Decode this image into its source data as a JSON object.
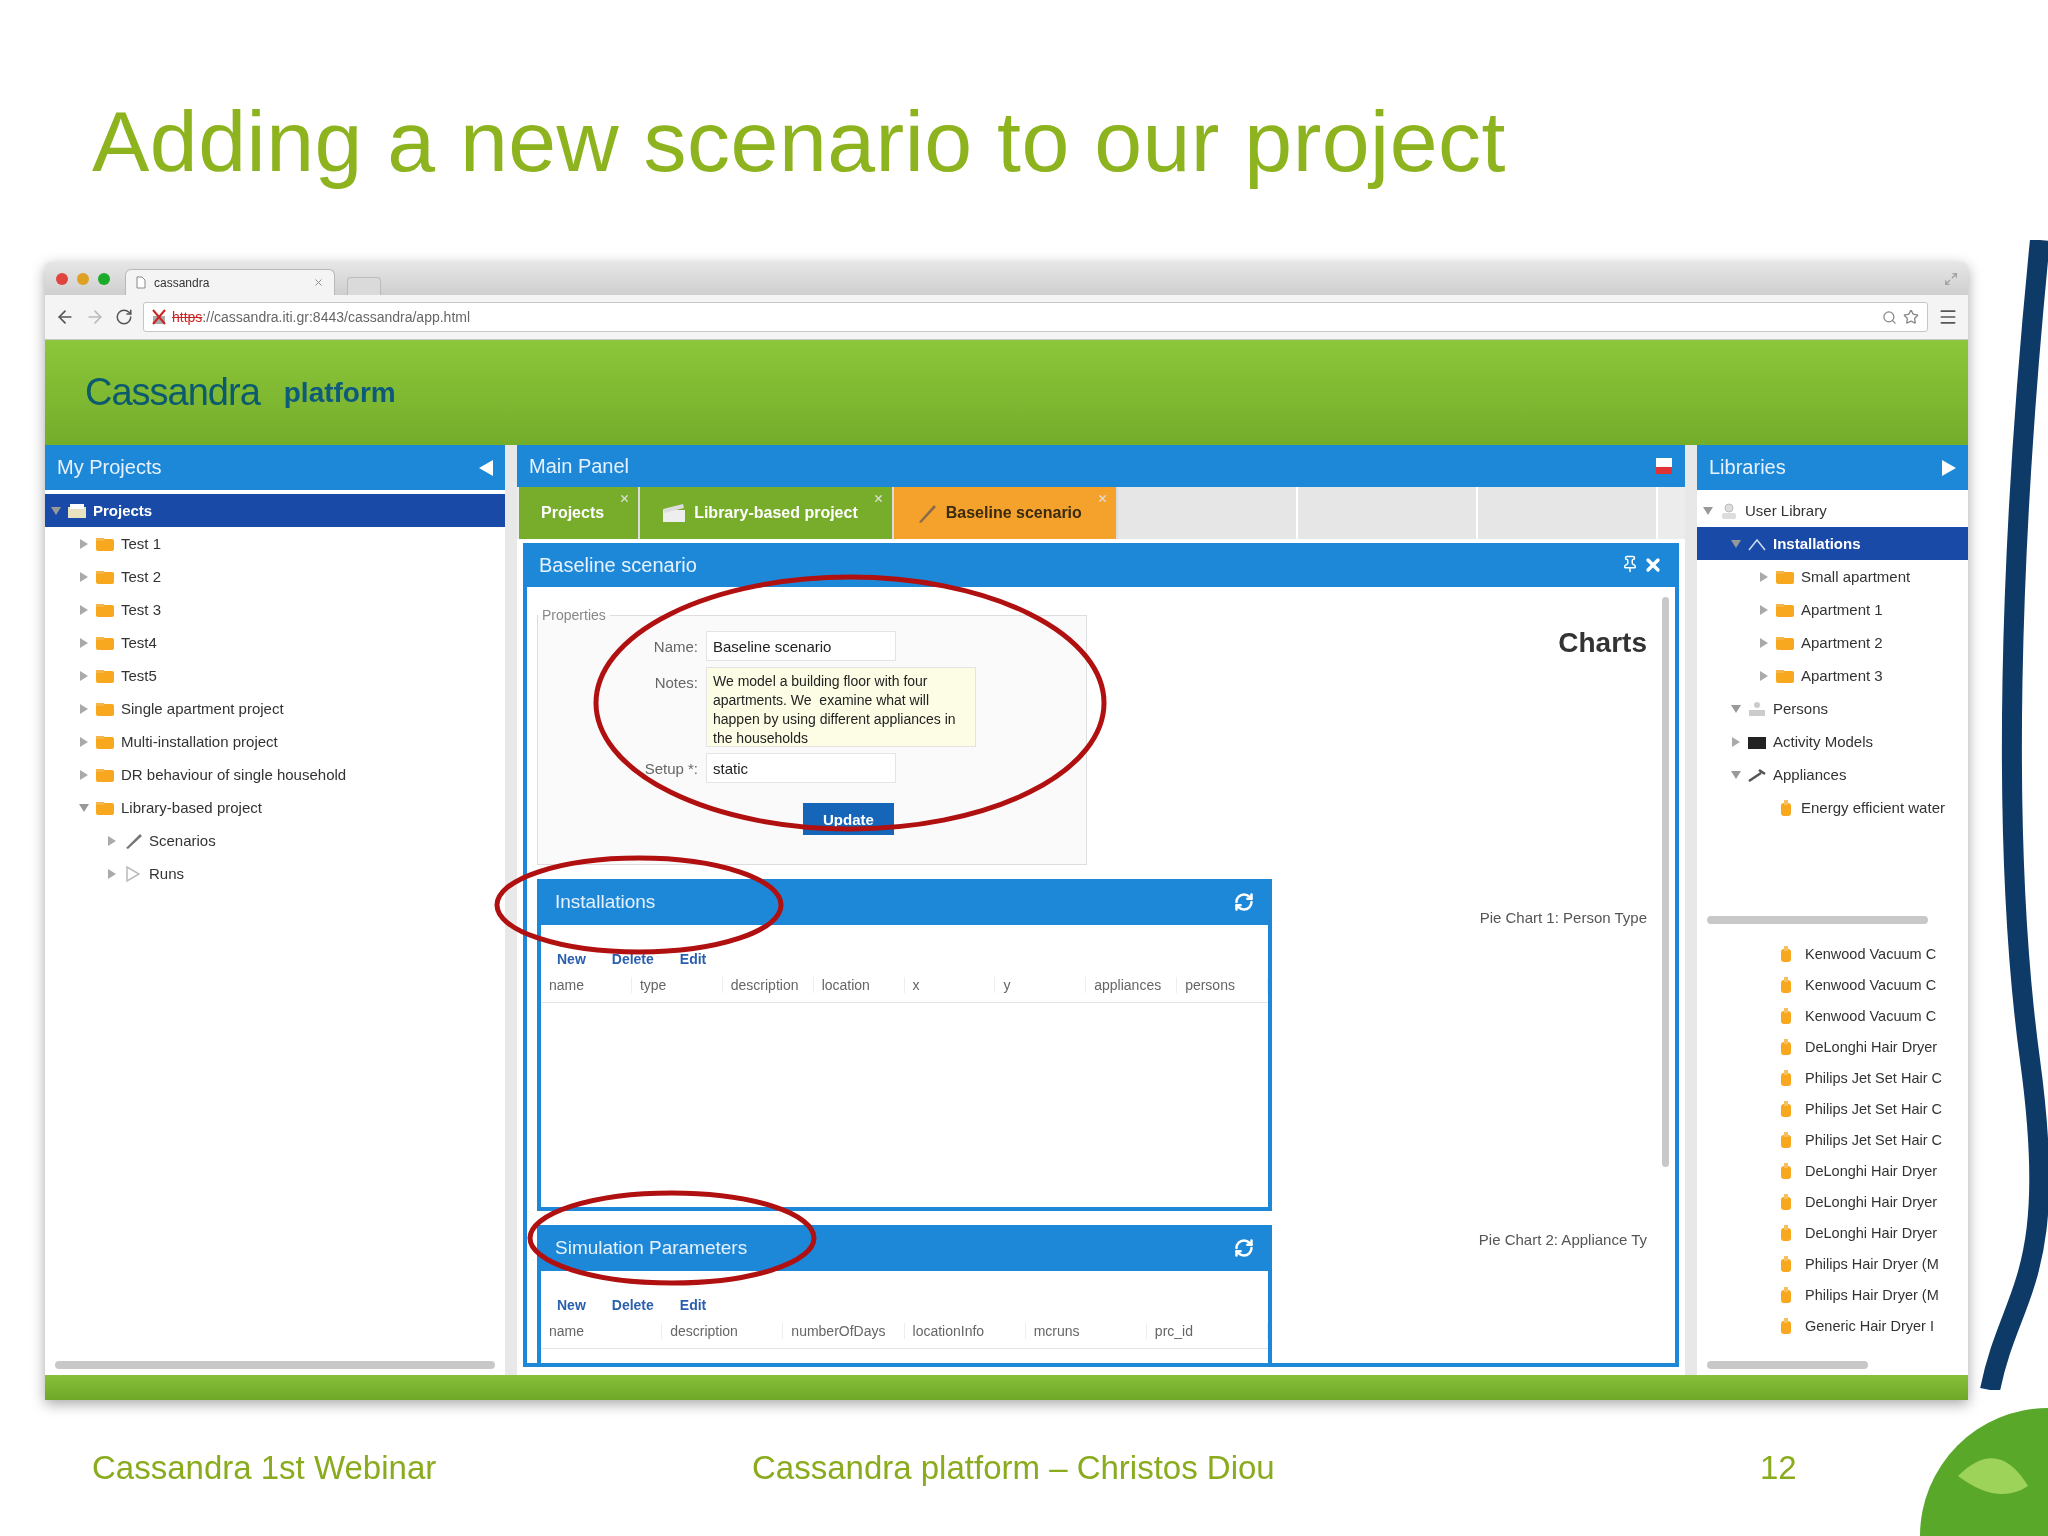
{
  "slide": {
    "title": "Adding a new scenario to our project",
    "footer": [
      "Cassandra 1st Webinar",
      "Cassandra platform – Christos Diou",
      "12"
    ]
  },
  "browser": {
    "tab_title": "cassandra",
    "url_scheme": "https",
    "url_rest": "://cassandra.iti.gr:8443/cassandra/app.html"
  },
  "header": {
    "logo": "Cassandra",
    "subtitle": "platform"
  },
  "my_projects": {
    "title": "My Projects",
    "tree": [
      {
        "label": "Projects",
        "kind": "projects",
        "expanded": true,
        "selected": true,
        "children": [
          {
            "label": "Test 1",
            "kind": "folder",
            "expanded": false,
            "selected": false
          },
          {
            "label": "Test 2",
            "kind": "folder",
            "expanded": false,
            "selected": false
          },
          {
            "label": "Test 3",
            "kind": "folder",
            "expanded": false,
            "selected": false
          },
          {
            "label": "Test4",
            "kind": "folder",
            "expanded": false,
            "selected": false
          },
          {
            "label": "Test5",
            "kind": "folder",
            "expanded": false,
            "selected": false
          },
          {
            "label": "Single apartment project",
            "kind": "folder",
            "expanded": false,
            "selected": false
          },
          {
            "label": "Multi-installation project",
            "kind": "folder",
            "expanded": false,
            "selected": false
          },
          {
            "label": "DR behaviour of single household",
            "kind": "folder",
            "expanded": false,
            "selected": false
          },
          {
            "label": "Library-based project",
            "kind": "folder",
            "expanded": true,
            "selected": false,
            "children": [
              {
                "label": "Scenarios",
                "kind": "pencil",
                "expanded": false,
                "selected": false
              },
              {
                "label": "Runs",
                "kind": "play",
                "expanded": false,
                "selected": false
              }
            ]
          }
        ]
      }
    ]
  },
  "main_panel": {
    "title": "Main Panel",
    "tabs": [
      {
        "label": "Projects",
        "kind": "plain",
        "selected": false
      },
      {
        "label": "Library-based project",
        "kind": "clapper",
        "selected": false
      },
      {
        "label": "Baseline scenario",
        "kind": "pencil",
        "selected": true
      }
    ],
    "scenario": {
      "title": "Baseline scenario",
      "legend": "Properties",
      "fields": [
        {
          "label": "Name:",
          "kind": "input",
          "value": "Baseline scenario"
        },
        {
          "label": "Notes:",
          "kind": "textarea",
          "value": "We model a building floor with four apartments. We  examine what will happen by using different appliances in the households"
        },
        {
          "label": "Setup *:",
          "kind": "input",
          "value": "static"
        }
      ],
      "button": "Update",
      "charts_title": "Charts",
      "chart_labels": [
        "Pie Chart 1: Person Type",
        "Pie Chart 2: Appliance Ty"
      ],
      "sections": [
        {
          "title": "Installations",
          "actions": [
            "New",
            "Delete",
            "Edit"
          ],
          "columns": [
            "name",
            "type",
            "description",
            "location",
            "x",
            "y",
            "appliances",
            "persons"
          ]
        },
        {
          "title": "Simulation Parameters",
          "actions": [
            "New",
            "Delete",
            "Edit"
          ],
          "columns": [
            "name",
            "description",
            "numberOfDays",
            "locationInfo",
            "mcruns",
            "prc_id"
          ]
        }
      ]
    }
  },
  "libraries": {
    "title": "Libraries",
    "tree": [
      {
        "label": "User Library",
        "kind": "user",
        "expanded": true,
        "selected": false,
        "children": [
          {
            "label": "Installations",
            "kind": "installation",
            "expanded": true,
            "selected": true,
            "children": [
              {
                "label": "Small apartment",
                "kind": "folder",
                "expanded": false,
                "selected": false
              },
              {
                "label": "Apartment 1",
                "kind": "folder",
                "expanded": false,
                "selected": false
              },
              {
                "label": "Apartment 2",
                "kind": "folder",
                "expanded": false,
                "selected": false
              },
              {
                "label": "Apartment 3",
                "kind": "folder",
                "expanded": false,
                "selected": false
              }
            ]
          },
          {
            "label": "Persons",
            "kind": "persons",
            "expanded": true,
            "selected": false
          },
          {
            "label": "Activity Models",
            "kind": "activity",
            "expanded": false,
            "selected": false
          },
          {
            "label": "Appliances",
            "kind": "appliances",
            "expanded": true,
            "selected": false,
            "children": [
              {
                "label": "Energy efficient water",
                "kind": "appliance",
                "selected": false
              }
            ]
          }
        ]
      }
    ],
    "appliance_list": [
      "Kenwood Vacuum C",
      "Kenwood Vacuum C",
      "Kenwood Vacuum C",
      "DeLonghi Hair Dryer",
      "Philips Jet Set Hair C",
      "Philips Jet Set Hair C",
      "Philips Jet Set Hair C",
      "DeLonghi Hair Dryer",
      "DeLonghi Hair Dryer",
      "DeLonghi Hair Dryer",
      "Philips Hair Dryer (M",
      "Philips Hair Dryer (M",
      "Generic Hair Dryer I"
    ]
  }
}
